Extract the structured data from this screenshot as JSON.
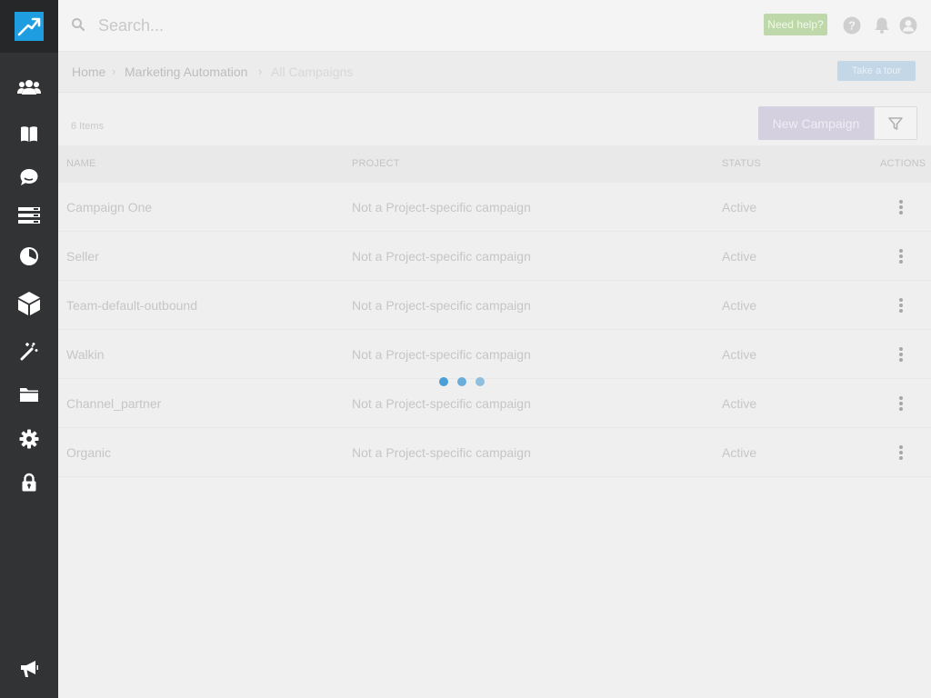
{
  "search": {
    "placeholder": "Search..."
  },
  "header": {
    "help_label": "Need help?"
  },
  "breadcrumb": {
    "items": [
      "Home",
      "Marketing Automation",
      "All Campaigns"
    ]
  },
  "tour": {
    "label": "Take a tour"
  },
  "toolbar": {
    "item_count": "6 Items",
    "new_campaign_label": "New Campaign"
  },
  "table": {
    "headers": {
      "name": "NAME",
      "project": "PROJECT",
      "status": "STATUS",
      "actions": "ACTIONS"
    },
    "rows": [
      {
        "name": "Campaign One",
        "project": "Not a Project-specific campaign",
        "status": "Active"
      },
      {
        "name": "Seller",
        "project": "Not a Project-specific campaign",
        "status": "Active"
      },
      {
        "name": "Team-default-outbound",
        "project": "Not a Project-specific campaign",
        "status": "Active"
      },
      {
        "name": "Walkin",
        "project": "Not a Project-specific campaign",
        "status": "Active"
      },
      {
        "name": "Channel_partner",
        "project": "Not a Project-specific campaign",
        "status": "Active"
      },
      {
        "name": "Organic",
        "project": "Not a Project-specific campaign",
        "status": "Active"
      }
    ]
  },
  "sidebar": {
    "icons": [
      "users-icon",
      "book-icon",
      "chat-icon",
      "list-icon",
      "pie-chart-icon",
      "cube-icon",
      "magic-wand-icon",
      "folder-icon",
      "gear-icon",
      "lock-icon",
      "megaphone-icon"
    ]
  },
  "colors": {
    "sidebar": "#323335",
    "logo": "#1e9ee0",
    "help_button": "#bfd8a9",
    "tour_button": "#c3d7e6",
    "new_campaign_button": "#d4d0e0",
    "loader": "#4a9fd6"
  }
}
